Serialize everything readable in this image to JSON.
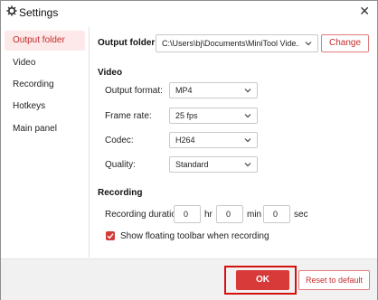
{
  "window": {
    "title": "Settings",
    "app_icon": "gear-icon",
    "close_glyph": "✕"
  },
  "sidebar": {
    "items": [
      {
        "label": "Output folder",
        "active": true
      },
      {
        "label": "Video",
        "active": false
      },
      {
        "label": "Recording",
        "active": false
      },
      {
        "label": "Hotkeys",
        "active": false
      },
      {
        "label": "Main panel",
        "active": false
      }
    ]
  },
  "output": {
    "label": "Output folder",
    "path": "C:\\Users\\bj\\Documents\\MiniTool Vide...",
    "change_label": "Change"
  },
  "video": {
    "section_title": "Video",
    "format": {
      "label": "Output format:",
      "value": "MP4"
    },
    "frame_rate": {
      "label": "Frame rate:",
      "value": "25 fps"
    },
    "codec": {
      "label": "Codec:",
      "value": "H264"
    },
    "quality": {
      "label": "Quality:",
      "value": "Standard"
    }
  },
  "recording": {
    "section_title": "Recording",
    "duration_label": "Recording duration",
    "hours": "0",
    "hr_unit": "hr",
    "minutes": "0",
    "min_unit": "min",
    "seconds": "0",
    "sec_unit": "sec",
    "floating_toolbar_label": "Show floating toolbar when recording",
    "floating_toolbar_checked": true
  },
  "footer": {
    "ok_label": "OK",
    "reset_label": "Reset to default"
  },
  "colors": {
    "accent": "#d83a3a",
    "highlight": "#d60f0f",
    "sidebar_active_bg": "#fde9e9"
  }
}
